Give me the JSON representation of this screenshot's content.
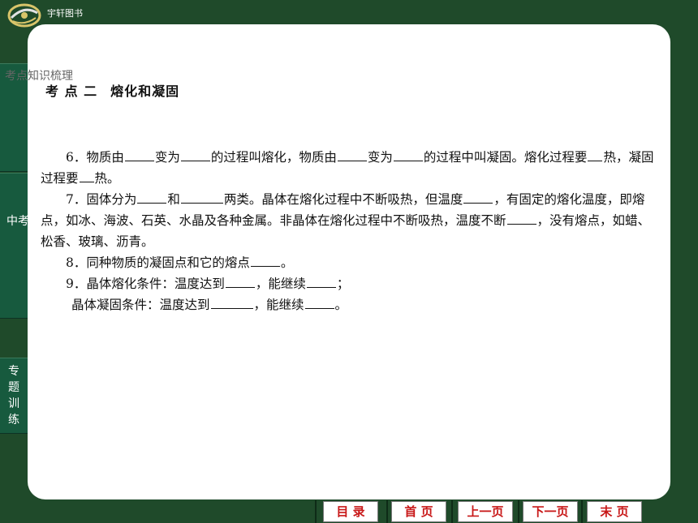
{
  "brand": "宇轩图书",
  "sidebar": {
    "knowledge_tab": "考点知识梳理",
    "exam_tab": "中考",
    "practice_tab": "专题训练"
  },
  "title": {
    "part1": "考 点 二",
    "part2": "熔化和凝固"
  },
  "content": {
    "p6a": "6．物质由",
    "p6b": "变为",
    "p6c": "的过程叫熔化，物质由",
    "p6d": "变为",
    "p6e": "的过程中叫凝固。熔化过程要",
    "p6f": "热，凝固过程要",
    "p6g": "热。",
    "p7a": "7．固体分为",
    "p7b": "和",
    "p7c": "两类。晶体在熔化过程中不断吸热，但温度",
    "p7d": "，有固定的熔化温度，即熔点，如冰、海波、石英、水晶及各种金属。非晶体在熔化过程中不断吸热，温度不断",
    "p7e": "，没有熔点，如蜡、松香、玻璃、沥青。",
    "p8a": "8．同种物质的凝固点和它的熔点",
    "p8b": "。",
    "p9a": "9．晶体熔化条件：温度达到",
    "p9b": "，能继续",
    "p9c": "；",
    "p10a": "晶体凝固条件：温度达到",
    "p10b": "，能继续",
    "p10c": "。"
  },
  "nav": {
    "toc": "目 录",
    "home": "首 页",
    "prev": "上一页",
    "next": "下一页",
    "last": "末 页"
  },
  "colors": {
    "background": "#1f4a2a",
    "sidebar_tab": "#175a3e",
    "nav_text": "#c81818"
  }
}
